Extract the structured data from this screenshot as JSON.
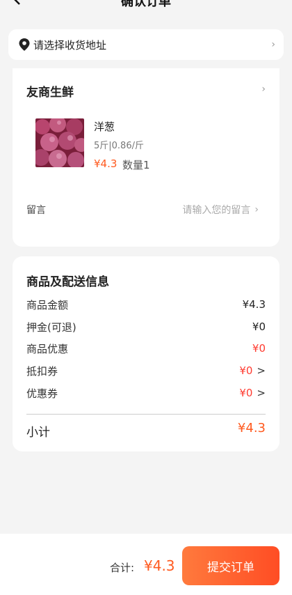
{
  "header": {
    "title": "确认订单"
  },
  "address": {
    "placeholder_text": "请选择收货地址"
  },
  "shop": {
    "name": "友商生鲜",
    "product": {
      "name": "洋葱",
      "spec": "5斤|0.86/斤",
      "price": "¥4.3",
      "quantity": "数量1"
    },
    "memo": {
      "label": "留言",
      "placeholder": "请输入您的留言"
    }
  },
  "info": {
    "title": "商品及配送信息",
    "rows": [
      {
        "label": "商品金额",
        "value": "¥4.3"
      },
      {
        "label": "押金(可退)",
        "value": "¥0"
      },
      {
        "label": "商品优惠",
        "value": "¥0"
      },
      {
        "label": "抵扣券",
        "value": "¥0",
        "arrow": ">"
      },
      {
        "label": "优惠券",
        "value": "¥0",
        "arrow": ">"
      }
    ],
    "subtotal_label": "小计",
    "subtotal_value": "¥4.3"
  },
  "footer": {
    "total_label": "合计:",
    "total_value": "¥4.3",
    "submit_label": "提交订单"
  },
  "colors": {
    "accent": "#ff5a1f",
    "discount_red": "#ff3b30",
    "background": "#f4f4f4"
  }
}
